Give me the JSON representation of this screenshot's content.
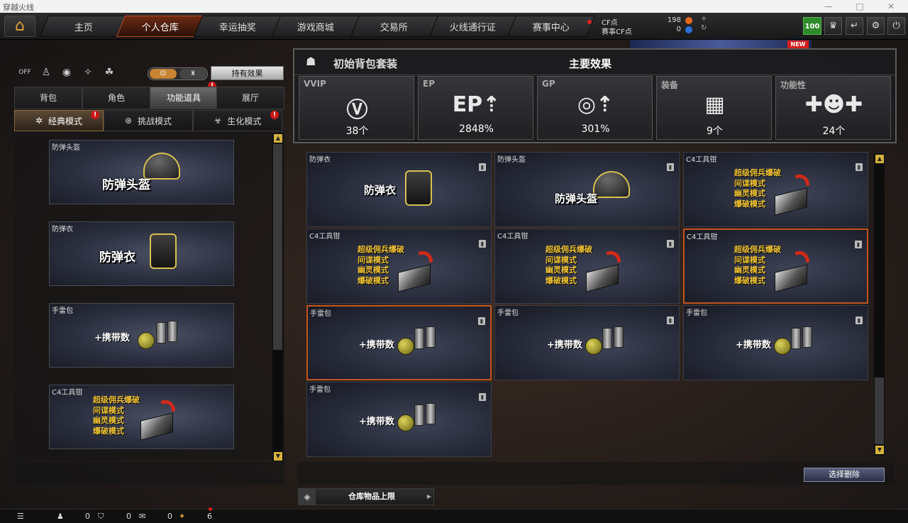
{
  "window": {
    "title": "穿越火线"
  },
  "nav": {
    "tabs": [
      "主页",
      "个人仓库",
      "幸运抽奖",
      "游戏商城",
      "交易所",
      "火线通行证",
      "赛事中心"
    ]
  },
  "currency": {
    "cf_label": "CF点",
    "cf_value": "198",
    "match_label": "赛事CF点",
    "match_value": "0"
  },
  "level": "100",
  "left": {
    "toggle_off": "OFF",
    "effect_button": "持有效果",
    "sub_tabs": [
      "背包",
      "角色",
      "功能道具",
      "展厅"
    ],
    "mode_tabs": [
      "经典模式",
      "挑战模式",
      "生化模式"
    ],
    "mode_badge": "!",
    "cards": [
      {
        "label": "防弹头盔",
        "big": "防弹头盔"
      },
      {
        "label": "防弹衣",
        "big": "防弹衣"
      },
      {
        "label": "手雷包",
        "big": "+携带数"
      },
      {
        "label": "C4工具钳",
        "modes": [
          "超级佣兵爆破",
          "间谍模式",
          "幽灵模式",
          "爆破模式"
        ]
      }
    ]
  },
  "effects": {
    "set_name": "初始背包套装",
    "main_title": "主要效果",
    "boxes": [
      {
        "name": "VVIP",
        "value": "38个",
        "icon": "vvip-icon"
      },
      {
        "name": "EP",
        "value": "2848%",
        "icon": "ep-icon"
      },
      {
        "name": "GP",
        "value": "301%",
        "icon": "gp-icon"
      },
      {
        "name": "装备",
        "value": "9个",
        "icon": "equipment-icon"
      },
      {
        "name": "功能性",
        "value": "24个",
        "icon": "function-icon"
      }
    ]
  },
  "grid": [
    {
      "label": "防弹衣",
      "big": "防弹衣"
    },
    {
      "label": "防弹头盔",
      "big": "防弹头盔"
    },
    {
      "label": "C4工具钳",
      "modes": [
        "超级佣兵爆破",
        "间谍模式",
        "幽灵模式",
        "爆破模式"
      ]
    },
    {
      "label": "C4工具钳",
      "modes": [
        "超级佣兵爆破",
        "间谍模式",
        "幽灵模式",
        "爆破模式"
      ]
    },
    {
      "label": "C4工具钳",
      "modes": [
        "超级佣兵爆破",
        "间谍模式",
        "幽灵模式",
        "爆破模式"
      ]
    },
    {
      "label": "C4工具钳",
      "modes": [
        "超级佣兵爆破",
        "间谍模式",
        "幽灵模式",
        "爆破模式"
      ],
      "selected": true
    },
    {
      "label": "手雷包",
      "big": "+携带数",
      "selected": true
    },
    {
      "label": "手雷包",
      "big": "+携带数"
    },
    {
      "label": "手雷包",
      "big": "+携带数"
    },
    {
      "label": "手雷包",
      "big": "+携带数"
    }
  ],
  "buttons": {
    "delete": "选择删除",
    "capacity": "仓库物品上限"
  },
  "banner": {
    "new_tag": "NEW"
  },
  "status": {
    "count1": "0",
    "count2": "0",
    "count3": "0",
    "count4": "6"
  }
}
